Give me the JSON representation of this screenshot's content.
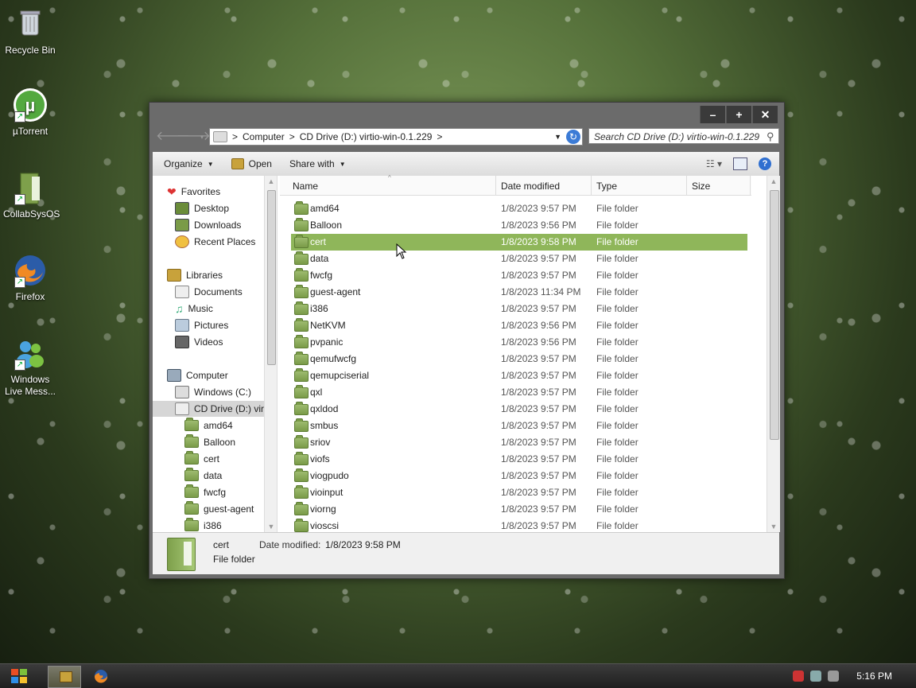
{
  "desktop": {
    "icons": [
      {
        "label": "Recycle Bin",
        "icon": "recycle-bin-icon"
      },
      {
        "label": "µTorrent",
        "icon": "utorrent-icon"
      },
      {
        "label": "CollabSysOS",
        "icon": "collabsysos-icon"
      },
      {
        "label": "Firefox",
        "icon": "firefox-icon"
      },
      {
        "label": "Windows Live Mess...",
        "icon": "windows-live-messenger-icon"
      }
    ]
  },
  "window": {
    "caption_buttons": {
      "minimize": "–",
      "maximize": "+",
      "close": "✕"
    },
    "address": {
      "crumbs": [
        "Computer",
        "CD Drive (D:) virtio-win-0.1.229"
      ],
      "sep": ">"
    },
    "search": {
      "placeholder": "Search CD Drive (D:) virtio-win-0.1.229"
    },
    "toolbar": {
      "organize": "Organize",
      "open": "Open",
      "share_with": "Share with"
    },
    "nav": {
      "favorites": {
        "label": "Favorites",
        "items": [
          "Desktop",
          "Downloads",
          "Recent Places"
        ]
      },
      "libraries": {
        "label": "Libraries",
        "items": [
          "Documents",
          "Music",
          "Pictures",
          "Videos"
        ]
      },
      "computer": {
        "label": "Computer",
        "items": [
          "Windows (C:)",
          "CD Drive (D:) virtio-win-0.1.229"
        ]
      },
      "cd_children": [
        "amd64",
        "Balloon",
        "cert",
        "data",
        "fwcfg",
        "guest-agent",
        "i386"
      ]
    },
    "columns": {
      "name": "Name",
      "date": "Date modified",
      "type": "Type",
      "size": "Size"
    },
    "files": [
      {
        "name": "amd64",
        "date": "1/8/2023 9:57 PM",
        "type": "File folder"
      },
      {
        "name": "Balloon",
        "date": "1/8/2023 9:56 PM",
        "type": "File folder"
      },
      {
        "name": "cert",
        "date": "1/8/2023 9:58 PM",
        "type": "File folder"
      },
      {
        "name": "data",
        "date": "1/8/2023 9:57 PM",
        "type": "File folder"
      },
      {
        "name": "fwcfg",
        "date": "1/8/2023 9:57 PM",
        "type": "File folder"
      },
      {
        "name": "guest-agent",
        "date": "1/8/2023 11:34 PM",
        "type": "File folder"
      },
      {
        "name": "i386",
        "date": "1/8/2023 9:57 PM",
        "type": "File folder"
      },
      {
        "name": "NetKVM",
        "date": "1/8/2023 9:56 PM",
        "type": "File folder"
      },
      {
        "name": "pvpanic",
        "date": "1/8/2023 9:56 PM",
        "type": "File folder"
      },
      {
        "name": "qemufwcfg",
        "date": "1/8/2023 9:57 PM",
        "type": "File folder"
      },
      {
        "name": "qemupciserial",
        "date": "1/8/2023 9:57 PM",
        "type": "File folder"
      },
      {
        "name": "qxl",
        "date": "1/8/2023 9:57 PM",
        "type": "File folder"
      },
      {
        "name": "qxldod",
        "date": "1/8/2023 9:57 PM",
        "type": "File folder"
      },
      {
        "name": "smbus",
        "date": "1/8/2023 9:57 PM",
        "type": "File folder"
      },
      {
        "name": "sriov",
        "date": "1/8/2023 9:57 PM",
        "type": "File folder"
      },
      {
        "name": "viofs",
        "date": "1/8/2023 9:57 PM",
        "type": "File folder"
      },
      {
        "name": "viogpudo",
        "date": "1/8/2023 9:57 PM",
        "type": "File folder"
      },
      {
        "name": "vioinput",
        "date": "1/8/2023 9:57 PM",
        "type": "File folder"
      },
      {
        "name": "viorng",
        "date": "1/8/2023 9:57 PM",
        "type": "File folder"
      },
      {
        "name": "vioscsi",
        "date": "1/8/2023 9:57 PM",
        "type": "File folder"
      }
    ],
    "selected_index": 2,
    "details": {
      "name": "cert",
      "date_label": "Date modified:",
      "date": "1/8/2023 9:58 PM",
      "type": "File folder"
    }
  },
  "taskbar": {
    "clock": "5:16 PM"
  },
  "colors": {
    "selection": "#8fb65a",
    "folder": "#7a9b48",
    "window_frame": "#6b6b6b"
  }
}
